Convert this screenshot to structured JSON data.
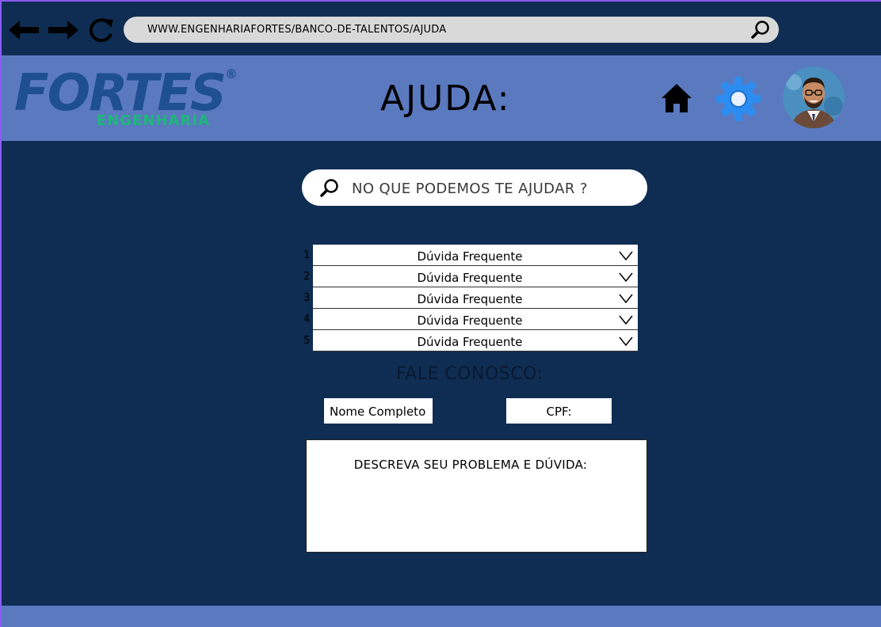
{
  "browser": {
    "url": "WWW.ENGENHARIAFORTES/BANCO-DE-TALENTOS/AJUDA"
  },
  "header": {
    "logo_main": "FORTES",
    "logo_sub": "ENGENHARIA",
    "logo_reg": "®",
    "title": "AJUDA:"
  },
  "search": {
    "placeholder": "NO QUE PODEMOS TE AJUDAR ?"
  },
  "faq": [
    {
      "num": "1",
      "label": "Dúvida Frequente"
    },
    {
      "num": "2",
      "label": "Dúvida Frequente"
    },
    {
      "num": "3",
      "label": "Dúvida Frequente"
    },
    {
      "num": "4",
      "label": "Dúvida Frequente"
    },
    {
      "num": "5",
      "label": "Dúvida Frequente"
    }
  ],
  "contact": {
    "title": "FALE CONOSCO:",
    "name_field": "Nome Completo",
    "cpf_field": "CPF:",
    "description_label": "DESCREVA SEU PROBLEMA E DÚVIDA:"
  },
  "colors": {
    "background": "#0f2d52",
    "header": "#5b79bf",
    "logo_blue": "#1d4f91",
    "logo_green": "#1db87a",
    "gear": "#2d8cf0"
  }
}
